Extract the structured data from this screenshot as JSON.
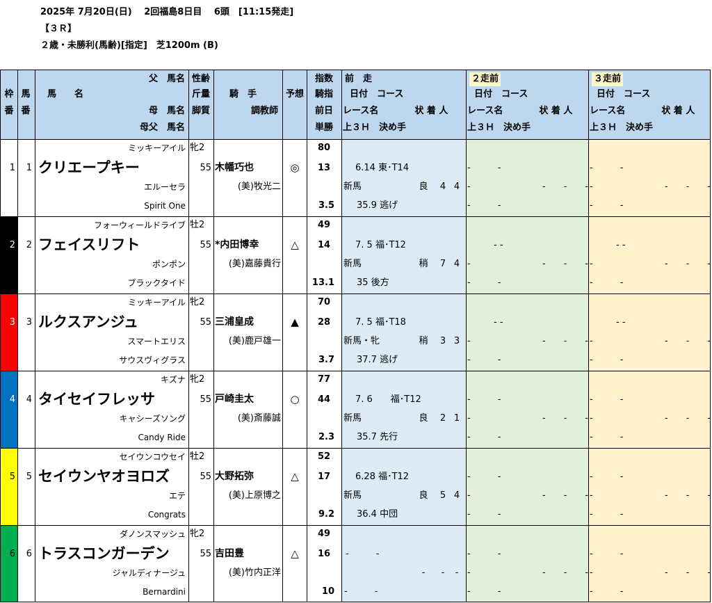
{
  "race": {
    "line1": "2025年 7月20日(日)　 2回福島8日目　 6頭　[11:15発走]",
    "line2": "【３Ｒ】",
    "line3": "２歳・未勝利(馬齢)[指定]　芝1200m (B)"
  },
  "header": {
    "waku": [
      "枠",
      "番"
    ],
    "uma": [
      "馬",
      "番"
    ],
    "sire": "父　馬名",
    "horse": "馬　　名",
    "dam": "母　馬名",
    "damsire": "母父　馬名",
    "sexage": "性齢",
    "weight": "斤量",
    "style": "脚質",
    "jockey": "騎　手",
    "trainer": "調教師",
    "yoso": "予想",
    "idx1": "指数",
    "idx2": "騎指",
    "idx3": "前日",
    "idx4": "単勝",
    "prev": [
      {
        "title": "前　走",
        "date_course": "日付　コース",
        "race_res": "レース名　　　　状 着 人",
        "last3f": "上３Ｈ　決め手"
      },
      {
        "title": "２走前",
        "date_course": "日付　コース",
        "race_res": "レース名　　　　状 着 人",
        "last3f": "上３Ｈ　決め手"
      },
      {
        "title": "３走前",
        "date_course": "日付　コース",
        "race_res": "レース名　　　　状 着 人",
        "last3f": "上３Ｈ　決め手"
      }
    ]
  },
  "horses": [
    {
      "waku": "1",
      "umaban": "1",
      "waku_color": "#ffffff",
      "waku_text": "#000000",
      "sire": "ミッキーアイル",
      "name": "クリエープキー",
      "dam": "エルーセラ",
      "damsire": "Spirit One",
      "sexage": "牝2",
      "weight": "55",
      "style": "",
      "jockey": "木幡巧也",
      "trainer": "(美)牧光二",
      "mark": "◎",
      "idx": "80",
      "jidx": "13",
      "prevday": "",
      "odds": "3.5",
      "prev1": {
        "date_course": "6.14 東･T14",
        "race": "新馬",
        "cond": "良",
        "rank": "4",
        "pop": "4",
        "last3f": "35.9 逃げ"
      }
    },
    {
      "waku": "2",
      "umaban": "2",
      "waku_color": "#000000",
      "waku_text": "#ffffff",
      "sire": "フォーウィールドライブ",
      "name": "フェイスリフト",
      "dam": "ポンポン",
      "damsire": "ブラックタイド",
      "sexage": "牡2",
      "weight": "55",
      "style": "",
      "jockey": "*内田博幸",
      "trainer": "(美)嘉藤貴行",
      "mark": "△",
      "idx": "49",
      "jidx": "14",
      "prevday": "",
      "odds": "13.1",
      "prev1": {
        "date_course": "7. 5 福･T12",
        "race": "新馬",
        "cond": "稍",
        "rank": "7",
        "pop": "4",
        "last3f": "35 後方"
      }
    },
    {
      "waku": "3",
      "umaban": "3",
      "waku_color": "#ff0000",
      "waku_text": "#ffffff",
      "sire": "ミッキーアイル",
      "name": "ルクスアンジュ",
      "dam": "スマートエリス",
      "damsire": "サウスヴィグラス",
      "sexage": "牝2",
      "weight": "55",
      "style": "",
      "jockey": "三浦皇成",
      "trainer": "(美)鹿戸雄一",
      "mark": "▲",
      "idx": "70",
      "jidx": "28",
      "prevday": "",
      "odds": "3.7",
      "prev1": {
        "date_course": "7. 5 福･T18",
        "race": "新馬・牝",
        "cond": "稍",
        "rank": "3",
        "pop": "3",
        "last3f": "37.7 逃げ"
      }
    },
    {
      "waku": "4",
      "umaban": "4",
      "waku_color": "#0070c0",
      "waku_text": "#ffffff",
      "sire": "キズナ",
      "name": "タイセイフレッサ",
      "dam": "キャシーズソング",
      "damsire": "Candy Ride",
      "sexage": "牝2",
      "weight": "55",
      "style": "",
      "jockey": "戸崎圭太",
      "trainer": "(美)斎藤誠",
      "mark": "○",
      "idx": "77",
      "jidx": "44",
      "prevday": "",
      "odds": "2.3",
      "prev1": {
        "date_course": "7. 6　　福･T12",
        "race": "新馬",
        "cond": "良",
        "rank": "2",
        "pop": "1",
        "last3f": "35.7 先行"
      }
    },
    {
      "waku": "5",
      "umaban": "5",
      "waku_color": "#ffff00",
      "waku_text": "#000000",
      "sire": "セイウンコウセイ",
      "name": "セイウンヤオヨロズ",
      "dam": "エテ",
      "damsire": "Congrats",
      "sexage": "牡2",
      "weight": "55",
      "style": "",
      "jockey": "大野拓弥",
      "trainer": "(美)上原博之",
      "mark": "△",
      "idx": "52",
      "jidx": "17",
      "prevday": "",
      "odds": "9.2",
      "prev1": {
        "date_course": "6.28 福･T12",
        "race": "新馬",
        "cond": "良",
        "rank": "5",
        "pop": "4",
        "last3f": "36.4 中団"
      }
    },
    {
      "waku": "6",
      "umaban": "6",
      "waku_color": "#00b050",
      "waku_text": "#000000",
      "sire": "ダノンスマッシュ",
      "name": "トラスコンガーデン",
      "dam": "ジャルディナージュ",
      "damsire": "Bernardini",
      "sexage": "牝2",
      "weight": "55",
      "style": "",
      "jockey": "吉田豊",
      "trainer": "(美)竹内正洋",
      "mark": "△",
      "idx": "49",
      "jidx": "16",
      "prevday": "",
      "odds": "10",
      "prev1": {
        "date_course": "-　　　-",
        "race": "",
        "cond": "-",
        "rank": "-",
        "pop": "-",
        "last3f": "-　　　-"
      }
    }
  ],
  "empty_prev": {
    "dash_pair": "-　　　-",
    "dash_short": "- -",
    "dash_single": "-",
    "dash_triple": "-　　-　　-"
  },
  "colors": {
    "header_bg": "#bdd7ee",
    "prev1_bg": "#ddebf7",
    "prev2_bg": "#e2efda",
    "prev3_bg": "#fff2cc",
    "title_highlight": "#fff7c8"
  }
}
